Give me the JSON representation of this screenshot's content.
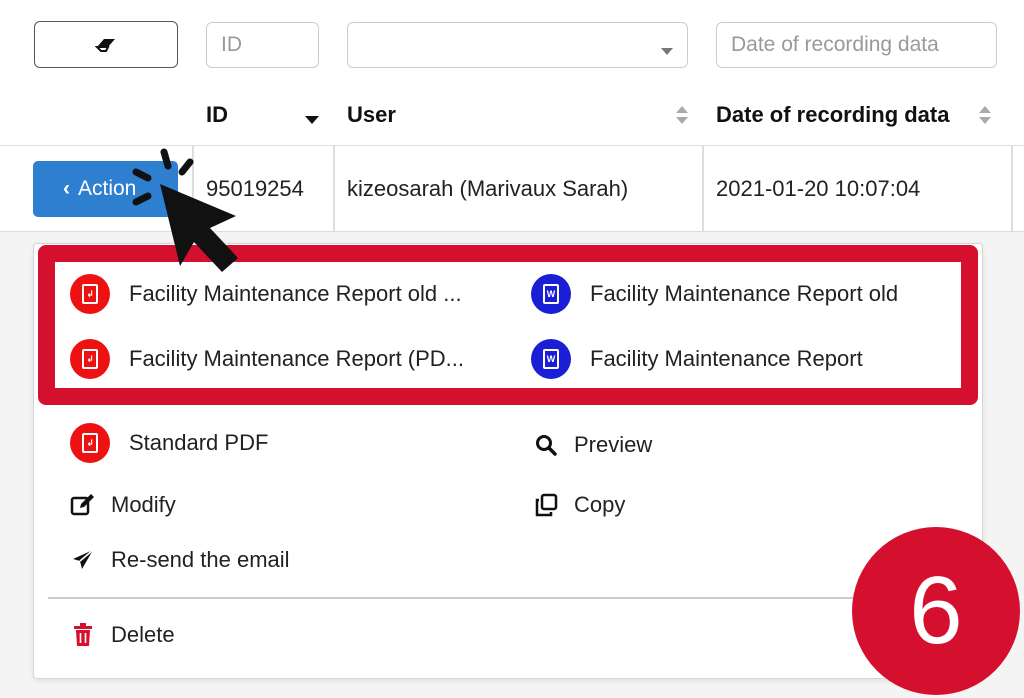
{
  "filters": {
    "id_placeholder": "ID",
    "user_value": "",
    "date_placeholder": "Date of recording data"
  },
  "columns": {
    "id": "ID",
    "user": "User",
    "date": "Date of recording data"
  },
  "row": {
    "action_label": "Action",
    "id": "95019254",
    "user": "kizeosarah (Marivaux Sarah)",
    "date": "2021-01-20 10:07:04"
  },
  "menu": {
    "highlighted": [
      {
        "label": "Facility Maintenance Report old ...",
        "icon": "pdf-icon"
      },
      {
        "label": "Facility Maintenance Report old",
        "icon": "word-icon"
      },
      {
        "label": "Facility Maintenance Report (PD...",
        "icon": "pdf-icon"
      },
      {
        "label": "Facility Maintenance Report",
        "icon": "word-icon"
      }
    ],
    "standard_pdf": "Standard PDF",
    "preview": "Preview",
    "modify": "Modify",
    "copy": "Copy",
    "resend": "Re-send the email",
    "delete": "Delete"
  },
  "step_badge": "6",
  "colors": {
    "highlight": "#d5102f",
    "action_button": "#2f7fd1",
    "pdf_icon": "#ee1111",
    "word_icon": "#1a1fd6",
    "delete_icon": "#d5102f"
  }
}
